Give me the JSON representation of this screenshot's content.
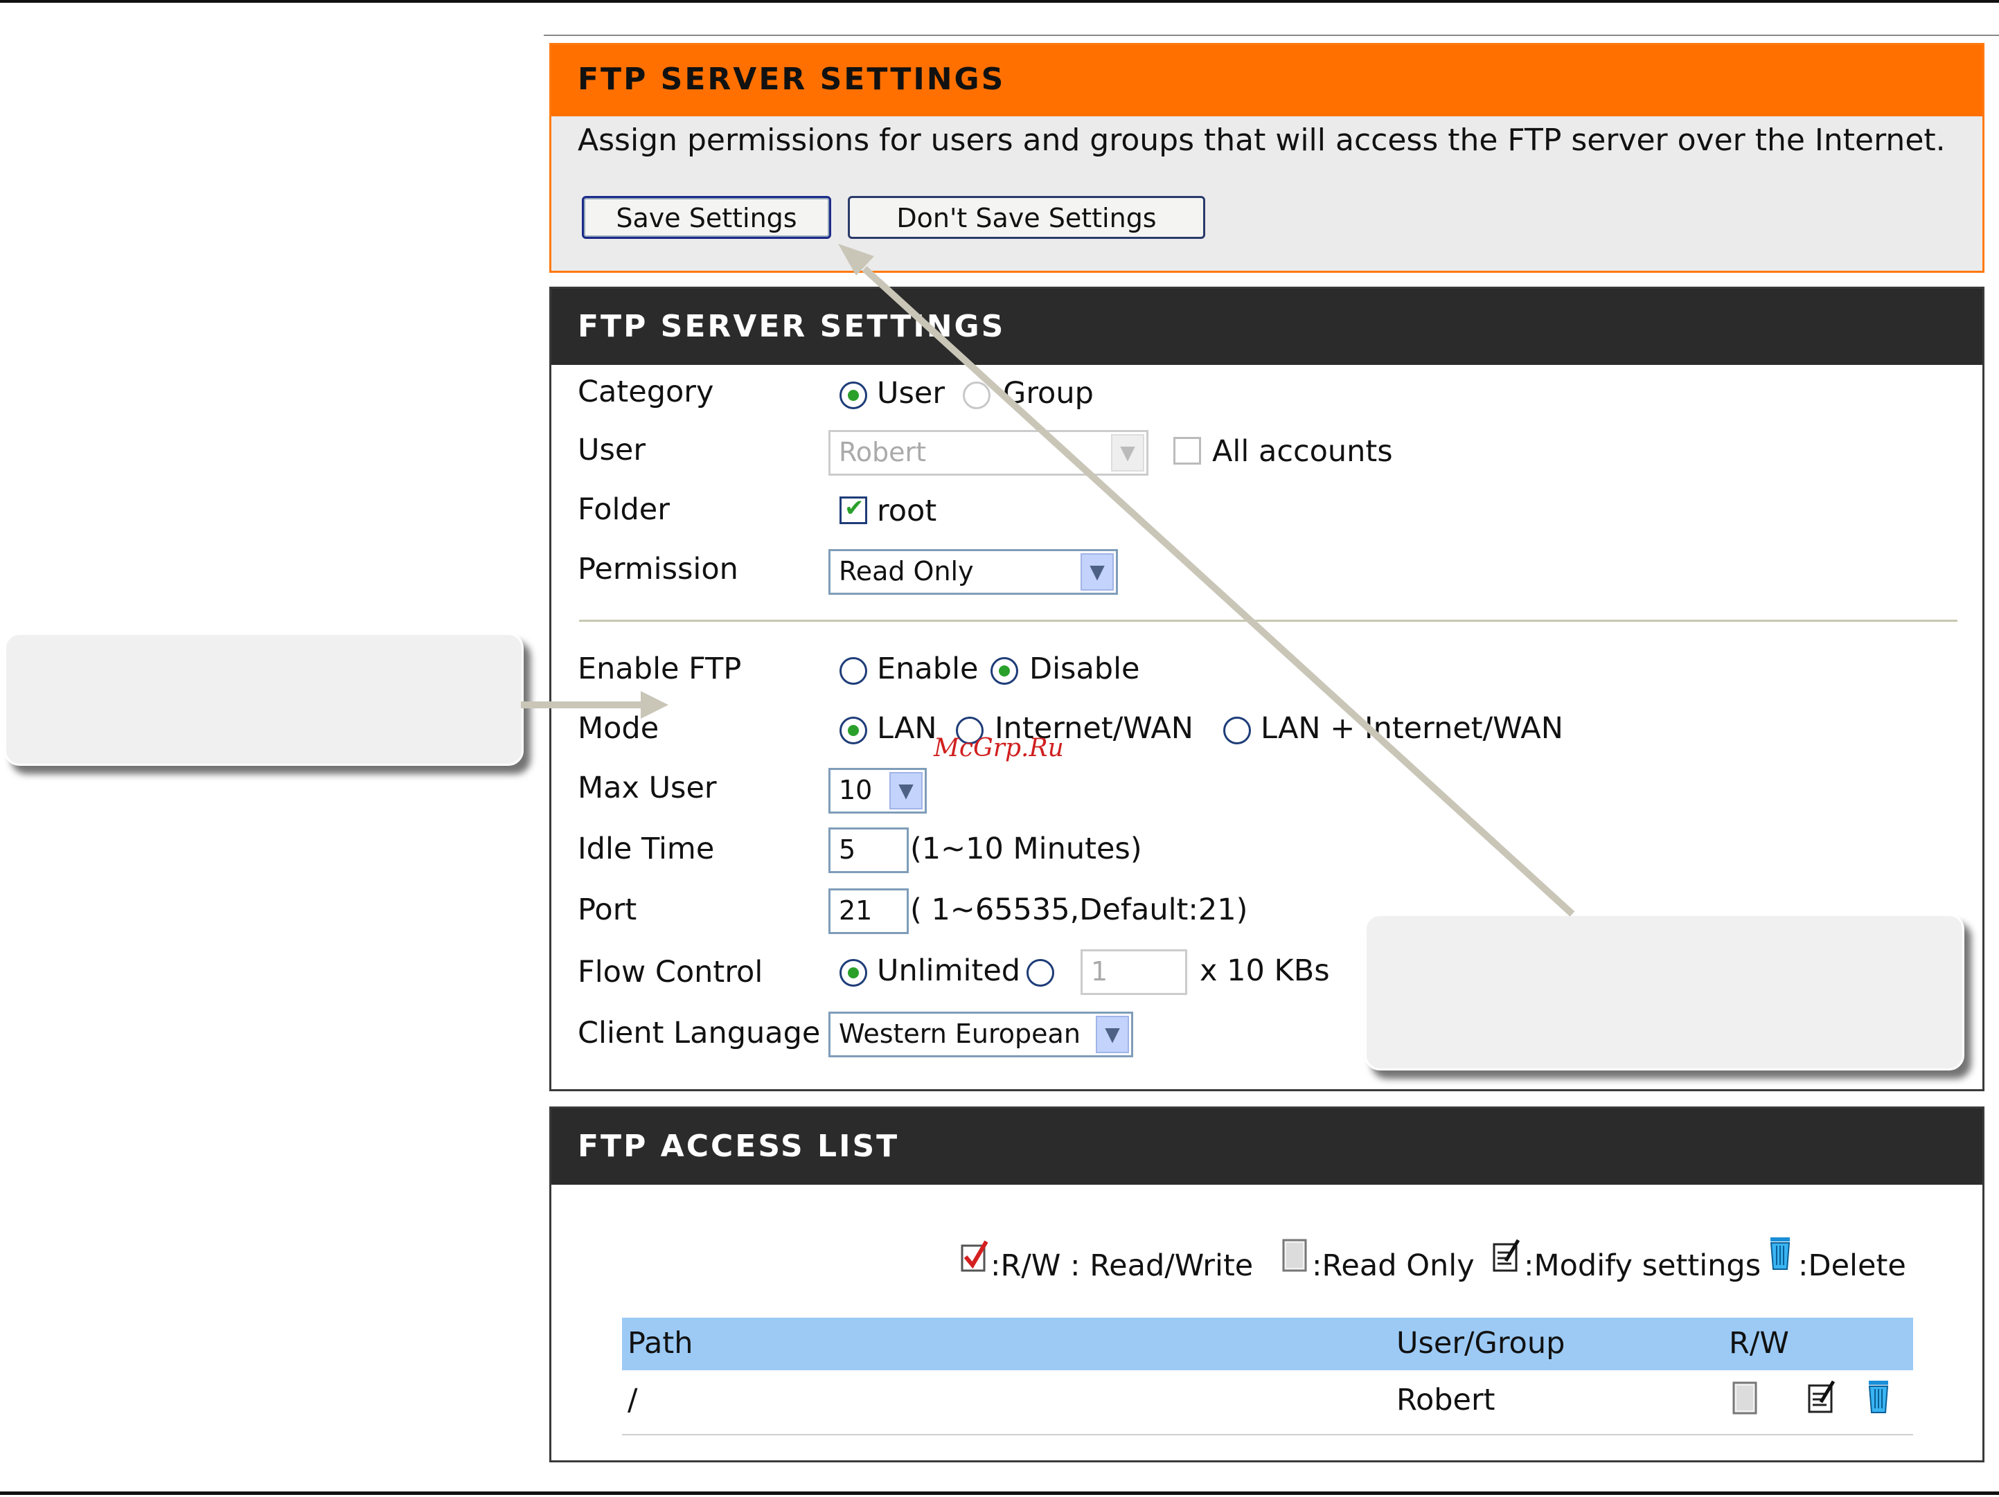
{
  "panel1": {
    "title": "FTP SERVER SETTINGS",
    "description": "Assign permissions for users and groups that will access the FTP server over the Internet.",
    "save_label": "Save Settings",
    "nosave_label": "Don't Save Settings"
  },
  "panel2": {
    "title": "FTP SERVER SETTINGS",
    "category": {
      "label": "Category",
      "options": [
        "User",
        "Group"
      ],
      "selected": "User"
    },
    "user": {
      "label": "User",
      "value": "Robert",
      "all_accounts_label": "All accounts"
    },
    "folder": {
      "label": "Folder",
      "value": "root"
    },
    "permission": {
      "label": "Permission",
      "value": "Read Only"
    },
    "enable_ftp": {
      "label": "Enable FTP",
      "options": [
        "Enable",
        "Disable"
      ],
      "selected": "Disable"
    },
    "mode": {
      "label": "Mode",
      "options": [
        "LAN",
        "Internet/WAN",
        "LAN + Internet/WAN"
      ],
      "selected": "LAN"
    },
    "max_user": {
      "label": "Max User",
      "value": "10"
    },
    "idle_time": {
      "label": "Idle Time",
      "value": "5",
      "hint": "(1~10 Minutes)"
    },
    "port": {
      "label": "Port",
      "value": "21",
      "hint": "( 1~65535,Default:21)"
    },
    "flow_control": {
      "label": "Flow Control",
      "option_label": "Unlimited",
      "value": "1",
      "unit": "x 10 KBs"
    },
    "client_language": {
      "label": "Client Language",
      "value": "Western European"
    }
  },
  "panel3": {
    "title": "FTP ACCESS LIST",
    "legend": {
      "rw": ":R/W : Read/Write",
      "read_only": ":Read Only",
      "modify": ":Modify settings",
      "delete": ":Delete"
    },
    "columns": [
      "Path",
      "User/Group",
      "R/W"
    ],
    "rows": [
      {
        "path": "/",
        "user": "Robert"
      }
    ]
  },
  "watermark": "McGrp.Ru",
  "icons": {
    "arrow_color": "#c9c6b8",
    "accent_orange": "#ff7000",
    "header_dark": "#2b2b2b",
    "table_head_blue": "#9ccaf5"
  }
}
